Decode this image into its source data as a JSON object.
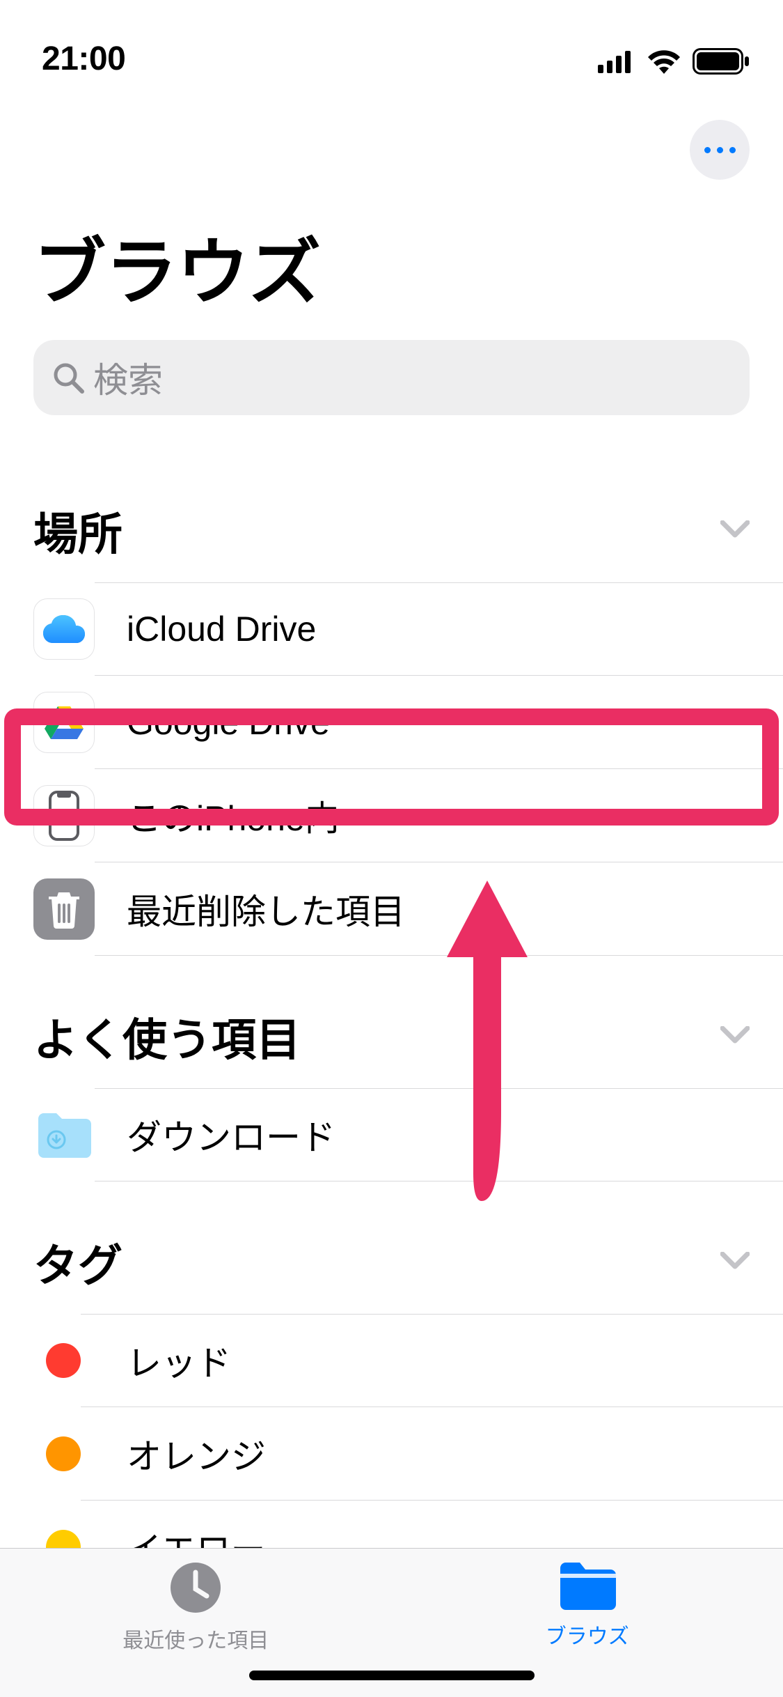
{
  "status": {
    "time": "21:00"
  },
  "page": {
    "title": "ブラウズ"
  },
  "search": {
    "placeholder": "検索"
  },
  "sections": {
    "locations": {
      "title": "場所",
      "items": [
        {
          "label": "iCloud Drive"
        },
        {
          "label": "Google Drive"
        },
        {
          "label": "このiPhone内"
        },
        {
          "label": "最近削除した項目"
        }
      ]
    },
    "favorites": {
      "title": "よく使う項目",
      "items": [
        {
          "label": "ダウンロード"
        }
      ]
    },
    "tags": {
      "title": "タグ",
      "items": [
        {
          "label": "レッド",
          "color": "#ff3b30"
        },
        {
          "label": "オレンジ",
          "color": "#ff9500"
        },
        {
          "label": "イエロー",
          "color": "#ffcc00"
        }
      ]
    }
  },
  "tabs": {
    "recents": "最近使った項目",
    "browse": "ブラウズ"
  }
}
